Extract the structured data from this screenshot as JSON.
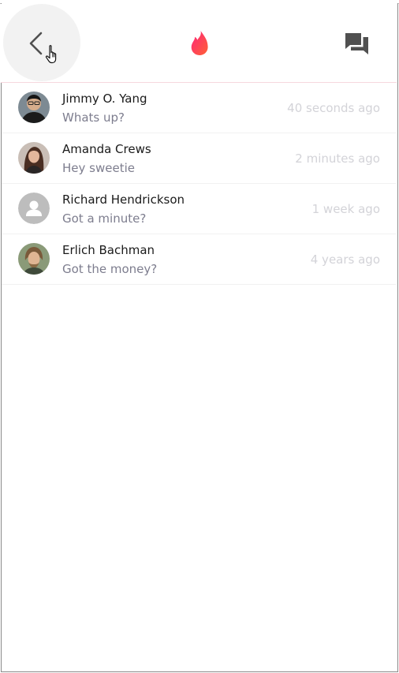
{
  "header": {
    "back_icon": "chevron-left-icon",
    "logo_icon": "flame-icon",
    "messages_icon": "chat-bubbles-icon",
    "logo_gradient": [
      "#fd267a",
      "#ff6036"
    ],
    "icon_color": "#505050"
  },
  "conversations": [
    {
      "name": "Jimmy O. Yang",
      "preview": "Whats up?",
      "time": "40 seconds ago",
      "avatar": "photo-avatar"
    },
    {
      "name": "Amanda Crews",
      "preview": "Hey sweetie",
      "time": "2 minutes ago",
      "avatar": "photo-avatar"
    },
    {
      "name": "Richard Hendrickson",
      "preview": "Got a minute?",
      "time": "1 week ago",
      "avatar": "default-person-avatar"
    },
    {
      "name": "Erlich Bachman",
      "preview": "Got the money?",
      "time": "4 years ago",
      "avatar": "photo-avatar"
    }
  ],
  "colors": {
    "name_text": "#1a1a1a",
    "preview_text": "#7d7d8e",
    "timestamp_text": "#d3d3d8",
    "header_divider": "#f6d8de"
  }
}
